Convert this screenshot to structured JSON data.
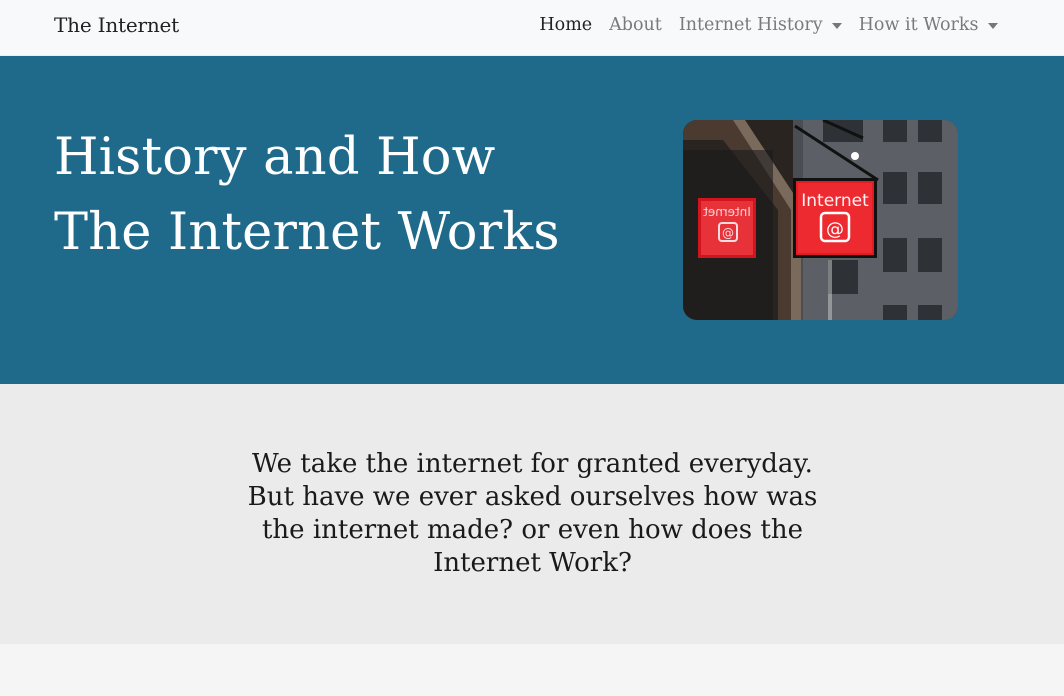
{
  "navbar": {
    "brand": "The Internet",
    "items": [
      {
        "label": "Home",
        "active": true,
        "dropdown": false
      },
      {
        "label": "About",
        "active": false,
        "dropdown": false
      },
      {
        "label": "Internet History",
        "active": false,
        "dropdown": true
      },
      {
        "label": "How it Works",
        "active": false,
        "dropdown": true
      }
    ]
  },
  "hero": {
    "title": "History and How The Internet Works",
    "image_sign_text": "Internet",
    "image_sign_reflection": "Internet",
    "background_color": "#1f6a8a"
  },
  "intro": {
    "text": "We take the internet for granted everyday. But have we ever asked ourselves how was the internet made? or even how does the Internet Work?"
  },
  "colors": {
    "navbar_bg": "#f8f9fa",
    "hero_bg": "#1f6a8a",
    "intro_bg": "#ebebeb",
    "sign_red": "#e31b23"
  }
}
